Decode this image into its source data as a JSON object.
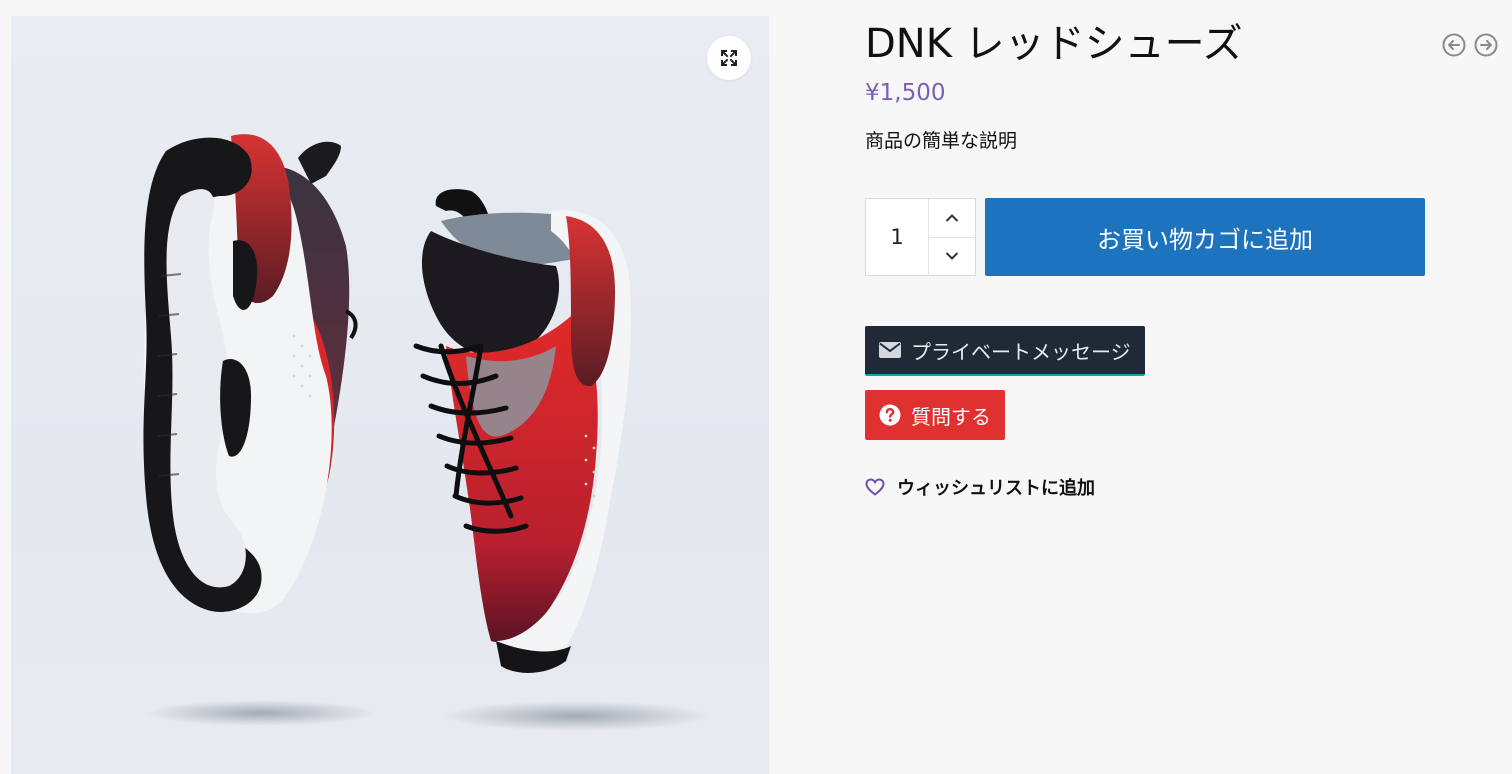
{
  "product": {
    "title": "DNK レッドシューズ",
    "price": "¥1,500",
    "short_description": "商品の簡単な説明",
    "image_icon": "product-photo-sneakers"
  },
  "gallery": {
    "zoom_icon": "expand-icon"
  },
  "cart": {
    "quantity": "1",
    "add_to_cart_label": "お買い物カゴに追加"
  },
  "actions": {
    "private_message_label": "プライベートメッセージ",
    "private_message_icon": "envelope-icon",
    "ask_question_label": "質問する",
    "ask_question_icon": "question-circle-icon",
    "wishlist_label": "ウィッシュリストに追加",
    "wishlist_icon": "heart-icon"
  },
  "pager": {
    "prev_icon": "arrow-left-circle-icon",
    "next_icon": "arrow-right-circle-icon"
  },
  "colors": {
    "background": "#f7f7f7",
    "price": "#7a5fb8",
    "add_to_cart": "#1e73be",
    "private_message": "#1f2a36",
    "ask_question": "#e03131",
    "wishlist_heart": "#6f4fb0"
  }
}
